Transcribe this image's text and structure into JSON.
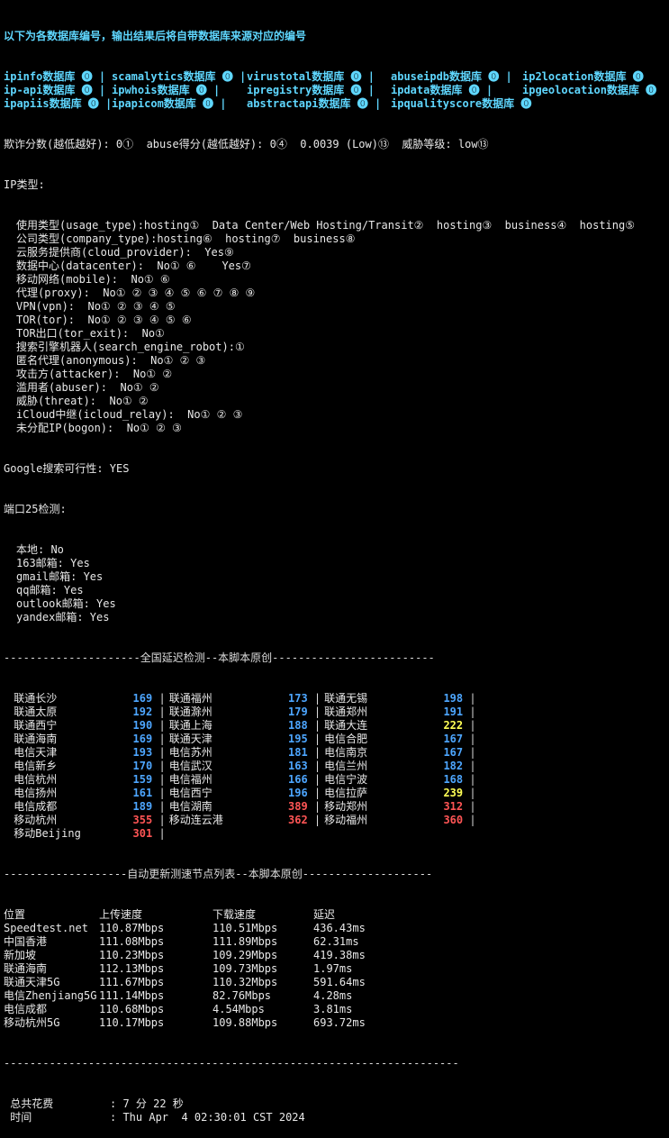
{
  "header": {
    "cut_line": "…… ……",
    "intro": "以下为各数据库编号，输出结果后将自带数据库来源对应的编号"
  },
  "db_rows": [
    [
      "ipinfo数据库",
      "scamalytics数据库",
      "virustotal数据库",
      "abuseipdb数据库",
      "ip2location数据库"
    ],
    [
      "ip-api数据库",
      "ipwhois数据库",
      "ipregistry数据库",
      "ipdata数据库",
      "ipgeolocation数据库"
    ],
    [
      "ipapiis数据库",
      "ipapicom数据库",
      "abstractapi数据库",
      "ipqualityscore数据库"
    ]
  ],
  "score_line": "欺诈分数(越低越好): 0①  abuse得分(越低越好): 0④  0.0039 (Low)⑬  威胁等级: low⑬",
  "ip_type_title": "IP类型:",
  "ip_type_lines": [
    "使用类型(usage_type):hosting①  Data Center/Web Hosting/Transit②  hosting③  business④  hosting⑤",
    "公司类型(company_type):hosting⑥  hosting⑦  business⑧",
    "云服务提供商(cloud_provider):  Yes⑨",
    "数据中心(datacenter):  No① ⑥    Yes⑦",
    "移动网络(mobile):  No① ⑥",
    "代理(proxy):  No① ② ③ ④ ⑤ ⑥ ⑦ ⑧ ⑨",
    "VPN(vpn):  No① ② ③ ④ ⑤",
    "TOR(tor):  No① ② ③ ④ ⑤ ⑥",
    "TOR出口(tor_exit):  No①",
    "搜索引擎机器人(search_engine_robot):①",
    "匿名代理(anonymous):  No① ② ③",
    "攻击方(attacker):  No① ②",
    "滥用者(abuser):  No① ②",
    "威胁(threat):  No① ②",
    "iCloud中继(icloud_relay):  No① ② ③",
    "未分配IP(bogon):  No① ② ③"
  ],
  "google_line": "Google搜索可行性: YES",
  "port25_title": "端口25检测:",
  "port25_lines": [
    "本地: No",
    "163邮箱: Yes",
    "gmail邮箱: Yes",
    "qq邮箱: Yes",
    "outlook邮箱: Yes",
    "yandex邮箱: Yes"
  ],
  "latency_header": "---------------------全国延迟检测--本脚本原创-------------------------",
  "latency_rows": [
    [
      {
        "name": "联通长沙",
        "v": "169",
        "c": "blue"
      },
      {
        "name": "联通福州",
        "v": "173",
        "c": "blue"
      },
      {
        "name": "联通无锡",
        "v": "198",
        "c": "blue"
      }
    ],
    [
      {
        "name": "联通太原",
        "v": "192",
        "c": "blue"
      },
      {
        "name": "联通滁州",
        "v": "179",
        "c": "blue"
      },
      {
        "name": "联通郑州",
        "v": "191",
        "c": "blue"
      }
    ],
    [
      {
        "name": "联通西宁",
        "v": "190",
        "c": "blue"
      },
      {
        "name": "联通上海",
        "v": "188",
        "c": "blue"
      },
      {
        "name": "联通大连",
        "v": "222",
        "c": "yellow"
      }
    ],
    [
      {
        "name": "联通海南",
        "v": "169",
        "c": "blue"
      },
      {
        "name": "联通天津",
        "v": "195",
        "c": "blue"
      },
      {
        "name": "电信合肥",
        "v": "167",
        "c": "blue"
      }
    ],
    [
      {
        "name": "电信天津",
        "v": "193",
        "c": "blue"
      },
      {
        "name": "电信苏州",
        "v": "181",
        "c": "blue"
      },
      {
        "name": "电信南京",
        "v": "167",
        "c": "blue"
      }
    ],
    [
      {
        "name": "电信新乡",
        "v": "170",
        "c": "blue"
      },
      {
        "name": "电信武汉",
        "v": "163",
        "c": "blue"
      },
      {
        "name": "电信兰州",
        "v": "182",
        "c": "blue"
      }
    ],
    [
      {
        "name": "电信杭州",
        "v": "159",
        "c": "blue"
      },
      {
        "name": "电信福州",
        "v": "166",
        "c": "blue"
      },
      {
        "name": "电信宁波",
        "v": "168",
        "c": "blue"
      }
    ],
    [
      {
        "name": "电信扬州",
        "v": "161",
        "c": "blue"
      },
      {
        "name": "电信西宁",
        "v": "196",
        "c": "blue"
      },
      {
        "name": "电信拉萨",
        "v": "239",
        "c": "yellow"
      }
    ],
    [
      {
        "name": "电信成都",
        "v": "189",
        "c": "blue"
      },
      {
        "name": "电信湖南",
        "v": "389",
        "c": "red"
      },
      {
        "name": "移动郑州",
        "v": "312",
        "c": "red"
      }
    ],
    [
      {
        "name": "移动杭州",
        "v": "355",
        "c": "red"
      },
      {
        "name": "移动连云港",
        "v": "362",
        "c": "red"
      },
      {
        "name": "移动福州",
        "v": "360",
        "c": "red"
      }
    ],
    [
      {
        "name": "移动Beijing",
        "v": "301",
        "c": "red"
      }
    ]
  ],
  "speed_header": "-------------------自动更新测速节点列表--本脚本原创--------------------",
  "speed_columns": [
    "位置",
    "上传速度",
    "下载速度",
    "延迟"
  ],
  "speed_rows": [
    [
      "Speedtest.net",
      "110.87Mbps",
      "110.51Mbps",
      "436.43ms"
    ],
    [
      "中国香港",
      "111.08Mbps",
      "111.89Mbps",
      "62.31ms"
    ],
    [
      "新加坡",
      "110.23Mbps",
      "109.29Mbps",
      "419.38ms"
    ],
    [
      "联通海南",
      "112.13Mbps",
      "109.73Mbps",
      "1.97ms"
    ],
    [
      "联通天津5G",
      "111.67Mbps",
      "110.32Mbps",
      "591.64ms"
    ],
    [
      "电信Zhenjiang5G",
      "111.14Mbps",
      "82.76Mbps",
      "4.28ms"
    ],
    [
      "电信成都",
      "110.68Mbps",
      "4.54Mbps",
      "3.81ms"
    ],
    [
      "移动杭州5G",
      "110.17Mbps",
      "109.88Mbps",
      "693.72ms"
    ]
  ],
  "footer_sep": "----------------------------------------------------------------------",
  "footer": [
    {
      "label": " 总共花费      ",
      "value": ": 7 分 22 秒"
    },
    {
      "label": " 时间          ",
      "value": ": Thu Apr  4 02:30:01 CST 2024"
    }
  ],
  "colors": {
    "background": "#000000",
    "cyan": "#5fd7ff",
    "blue": "#4da6ff",
    "yellow": "#ffff55",
    "red": "#ff5555"
  }
}
